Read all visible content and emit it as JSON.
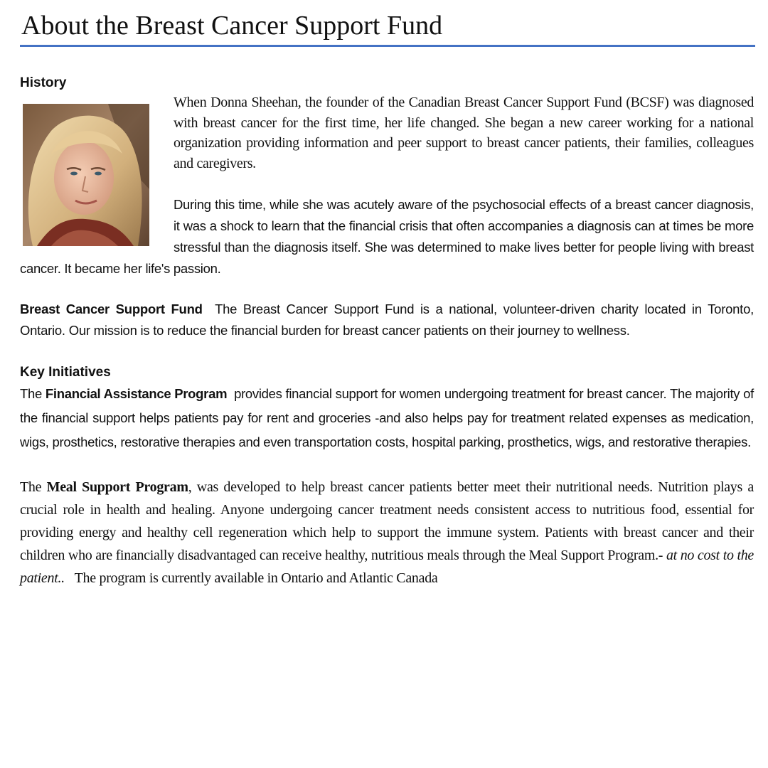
{
  "document": {
    "title": "About the Breast Cancer Support Fund",
    "accent_color": "#4472c4"
  },
  "history": {
    "heading": "History",
    "image_alt": "Portrait of Donna Sheehan",
    "paragraph1": "When Donna Sheehan, the founder of the Canadian Breast Cancer Support Fund (BCSF) was diagnosed with breast cancer for the first time, her life changed. She began a new career working for a national organization providing information and peer support to breast cancer patients, their families, colleagues and caregivers.",
    "paragraph2": "During this time, while she was acutely aware of the psychosocial effects of a breast cancer diagnosis, it was a shock to learn that the financial crisis that often accompanies a diagnosis can at times be more stressful than the diagnosis itself. She was determined to make lives better for people living with breast cancer. It became her life's passion."
  },
  "bcsf": {
    "lead": "Breast Cancer Support Fund",
    "text": "The Breast Cancer Support Fund is a national, volunteer-driven charity located in Toronto, Ontario. Our mission is to reduce the financial burden for breast cancer patients on their journey to wellness."
  },
  "key_initiatives": {
    "heading": "Key Initiatives",
    "fap": {
      "prefix": "The ",
      "program": "Financial Assistance Program",
      "text": "provides financial support for women undergoing treatment for breast cancer. The majority of the financial support helps patients pay for  rent and groceries -and also helps pay for treatment related expenses as medication, wigs, prosthetics, restorative therapies and even transportation costs, hospital parking, prosthetics, wigs, and  restorative therapies."
    },
    "meal": {
      "prefix": "The ",
      "program": "Meal Support Program",
      "text": ", was developed to help breast cancer patients better meet their nutritional needs.  Nutrition plays a crucial role in health and healing. Anyone undergoing cancer treatment needs consistent access to nutritious food, essential for providing energy and healthy cell regeneration which help to support the immune system. Patients with breast cancer and their children who are financially disadvantaged can receive healthy, nutritious meals through the Meal Support Program.- ",
      "italic": "at no cost to the patient..",
      "suffix": "   The program is currently available in Ontario and Atlantic Canada"
    }
  }
}
